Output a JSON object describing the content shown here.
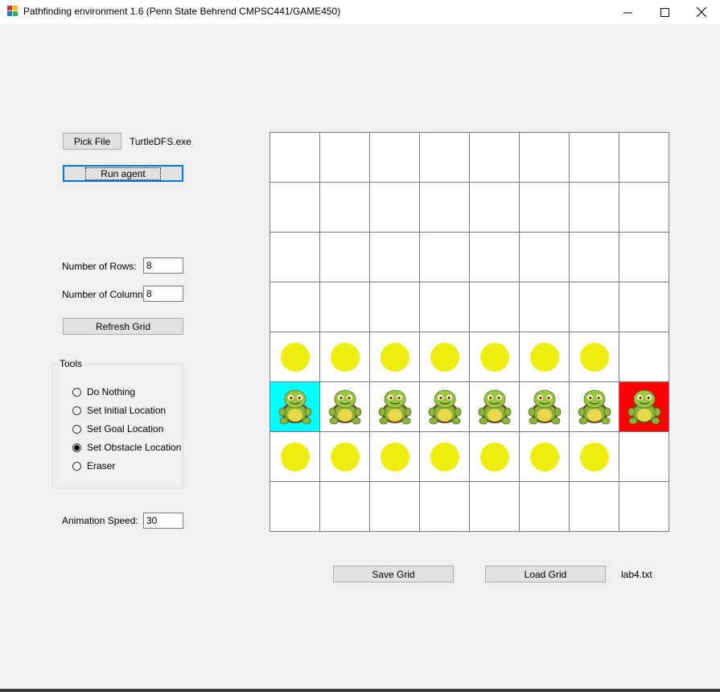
{
  "window": {
    "title": "Pathfinding environment 1.6 (Penn State Behrend CMPSC441/GAME450)"
  },
  "controls": {
    "pick_file_label": "Pick File",
    "agent_file": "TurtleDFS.exe",
    "run_agent_label": "Run agent",
    "rows_label": "Number of Rows:",
    "rows_value": "8",
    "cols_label": "Number of Columns:",
    "cols_value": "8",
    "refresh_label": "Refresh Grid",
    "animation_label": "Animation Speed:",
    "animation_value": "30"
  },
  "tools": {
    "title": "Tools",
    "options": [
      {
        "label": "Do Nothing",
        "checked": false
      },
      {
        "label": "Set Initial Location",
        "checked": false
      },
      {
        "label": "Set Goal Location",
        "checked": false
      },
      {
        "label": "Set Obstacle Location",
        "checked": true
      },
      {
        "label": "Eraser",
        "checked": false
      }
    ]
  },
  "grid": {
    "rows": 8,
    "cols": 8,
    "cells": [
      [
        "empty",
        "empty",
        "empty",
        "empty",
        "empty",
        "empty",
        "empty",
        "empty"
      ],
      [
        "empty",
        "empty",
        "empty",
        "empty",
        "empty",
        "empty",
        "empty",
        "empty"
      ],
      [
        "empty",
        "empty",
        "empty",
        "empty",
        "empty",
        "empty",
        "empty",
        "empty"
      ],
      [
        "empty",
        "empty",
        "empty",
        "empty",
        "empty",
        "empty",
        "empty",
        "empty"
      ],
      [
        "obstacle",
        "obstacle",
        "obstacle",
        "obstacle",
        "obstacle",
        "obstacle",
        "obstacle",
        "empty"
      ],
      [
        "start-turtle",
        "turtle",
        "turtle",
        "turtle",
        "turtle",
        "turtle",
        "turtle",
        "goal-turtle"
      ],
      [
        "obstacle",
        "obstacle",
        "obstacle",
        "obstacle",
        "obstacle",
        "obstacle",
        "obstacle",
        "empty"
      ],
      [
        "empty",
        "empty",
        "empty",
        "empty",
        "empty",
        "empty",
        "empty",
        "empty"
      ]
    ],
    "colors": {
      "start": "#00ffff",
      "goal": "#ff0000",
      "obstacle": "#eeee10"
    }
  },
  "footer": {
    "save_label": "Save Grid",
    "load_label": "Load Grid",
    "grid_file": "lab4.txt"
  }
}
